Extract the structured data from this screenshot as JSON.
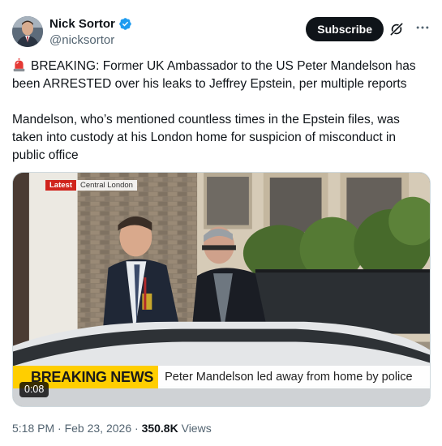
{
  "author": {
    "display_name": "Nick Sortor",
    "handle": "@nicksortor"
  },
  "actions": {
    "subscribe_label": "Subscribe"
  },
  "tweet": {
    "paragraph1": "BREAKING: Former UK Ambassador to the US Peter Mandelson has been ARRESTED over his leaks to Jeffrey Epstein, per multiple reports",
    "paragraph2": "Mandelson, who’s mentioned countless times in the Epstein files, was taken into custody at his London home for suspicion of misconduct in public office"
  },
  "media": {
    "tag_latest": "Latest",
    "tag_location": "Central London",
    "breaking_label": "BREAKING NEWS",
    "caption": "Peter Mandelson led away from home by police",
    "duration": "0:08"
  },
  "meta": {
    "time": "5:18 PM",
    "date": "Feb 23, 2026",
    "separator": "·",
    "views_count": "350.8K",
    "views_label": "Views"
  },
  "colors": {
    "verified_blue": "#1d9bf0",
    "breaking_yellow": "#ffce00",
    "latest_red": "#d0241d"
  },
  "icons": [
    "verified-badge-icon",
    "grok-icon",
    "more-icon",
    "siren-emoji-icon"
  ]
}
